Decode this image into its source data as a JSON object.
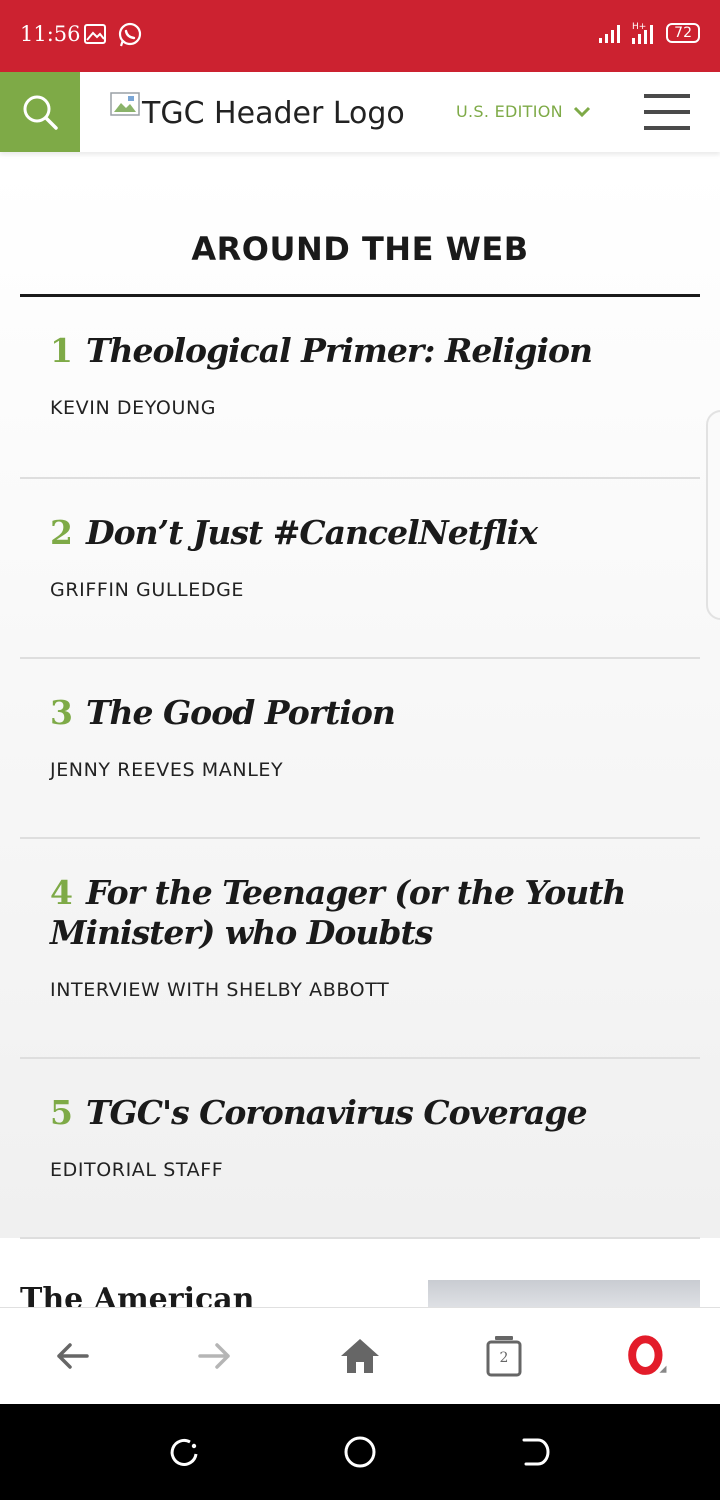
{
  "status_bar": {
    "time": "11:56",
    "battery": "72",
    "bg_color": "#cc2230",
    "left_icons": [
      "gallery-icon",
      "whatsapp-icon"
    ],
    "right_icons": [
      "signal-icon",
      "hplus-signal-icon",
      "battery-icon"
    ]
  },
  "header": {
    "logo_alt": "TGC Header Logo",
    "edition_label": "U.S. EDITION",
    "accent_color": "#7eaa47",
    "icons": [
      "search-icon",
      "broken-image-icon",
      "chevron-down-icon",
      "hamburger-menu-icon"
    ]
  },
  "section": {
    "title": "AROUND THE WEB",
    "items": [
      {
        "number": "1",
        "title": "Theological Primer: Religion",
        "author": "KEVIN DEYOUNG"
      },
      {
        "number": "2",
        "title": "Don’t Just #CancelNetflix",
        "author": "GRIFFIN GULLEDGE"
      },
      {
        "number": "3",
        "title": "The Good Portion",
        "author": "JENNY REEVES MANLEY"
      },
      {
        "number": "4",
        "title": "For the Teenager (or the Youth Minister) who Doubts",
        "author": "INTERVIEW WITH SHELBY ABBOTT"
      },
      {
        "number": "5",
        "title": "TGC's Coronavirus Coverage",
        "author": "EDITORIAL STAFF"
      }
    ]
  },
  "next_section": {
    "peek_text": "The American"
  },
  "browser_bar": {
    "tab_count": "2",
    "icons": [
      "back-arrow-icon",
      "forward-arrow-icon",
      "home-icon",
      "tabs-icon",
      "opera-icon"
    ]
  },
  "nav_bar": {
    "icons": [
      "recents-icon",
      "home-circle-icon",
      "back-icon"
    ]
  }
}
